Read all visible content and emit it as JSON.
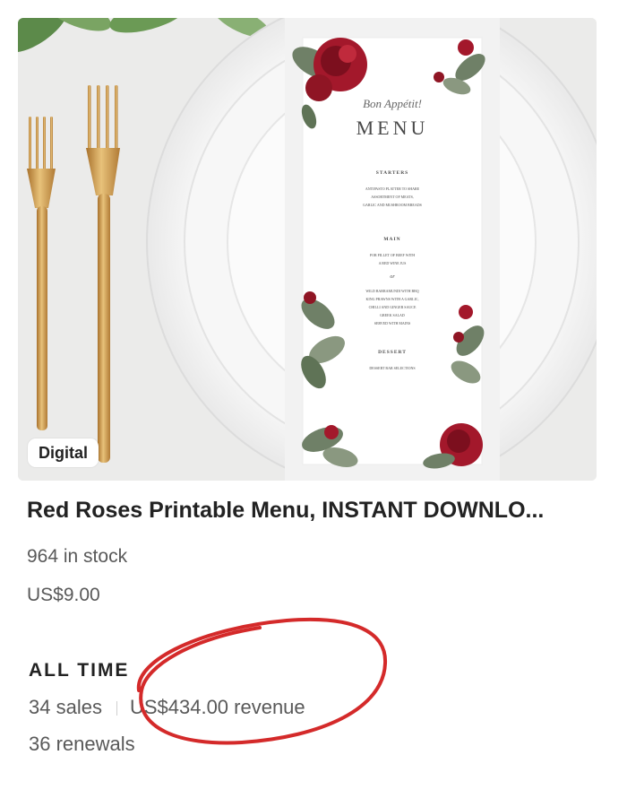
{
  "listing": {
    "badge": "Digital",
    "title": "Red Roses Printable Menu, INSTANT DOWNLO...",
    "stock": "964 in stock",
    "price": "US$9.00"
  },
  "menu_card": {
    "script_heading": "Bon Appétit!",
    "heading": "MENU",
    "starters_heading": "STARTERS",
    "starters_lines": [
      "ANTIPASTO PLATTER TO SHARE",
      "ASSORTMENT OF MEATS,",
      "GARLIC AND MUSHROOM BREADS"
    ],
    "mains_heading": "MAIN",
    "mains_lines": [
      "FOR FILLET OF BEEF WITH",
      "A RED WINE JUS"
    ],
    "or_text": "or",
    "mains_alt_lines": [
      "WILD BARRAMUNDI WITH BBQ",
      "KING PRAWNS WITH A GARLIC,",
      "CHILLI AND GINGER SAUCE",
      "GREEK SALAD",
      "SERVED WITH MAINS"
    ],
    "dessert_heading": "DESSERT",
    "dessert_lines": [
      "DESSERT BAR SELECTIONS"
    ]
  },
  "stats": {
    "heading": "ALL TIME",
    "sales": "34 sales",
    "revenue": "US$434.00 revenue",
    "renewals": "36 renewals"
  },
  "colors": {
    "annotation": "#d42a2a",
    "rose": "#a3182b",
    "gold": "#c9963f"
  }
}
